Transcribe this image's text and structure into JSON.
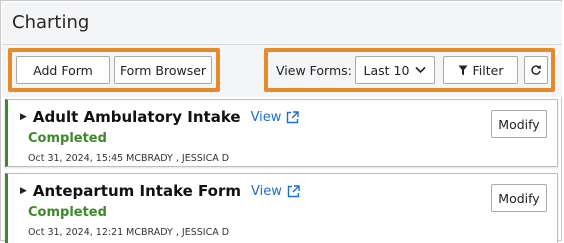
{
  "header": {
    "title": "Charting"
  },
  "toolbar": {
    "add_form": "Add Form",
    "form_browser": "Form Browser",
    "view_forms_label": "View Forms:",
    "view_forms_selected": "Last 10",
    "filter_label": "Filter"
  },
  "forms": [
    {
      "name": "Adult Ambulatory Intake",
      "view_label": "View",
      "status": "Completed",
      "meta": "Oct 31, 2024, 15:45  MCBRADY , JESSICA D",
      "modify_label": "Modify"
    },
    {
      "name": "Antepartum Intake Form",
      "view_label": "View",
      "status": "Completed",
      "meta": "Oct 31, 2024, 12:21  MCBRADY , JESSICA D",
      "modify_label": "Modify"
    }
  ],
  "colors": {
    "highlight": "#e58b2a",
    "link": "#1a6fcf",
    "status_green": "#3e8a2a",
    "card_accent": "#3d8a2e"
  },
  "icons": {
    "caret": "caret-right-icon",
    "external": "external-link-icon",
    "dropdown": "chevron-down-icon",
    "filter": "filter-icon",
    "refresh": "refresh-icon"
  }
}
